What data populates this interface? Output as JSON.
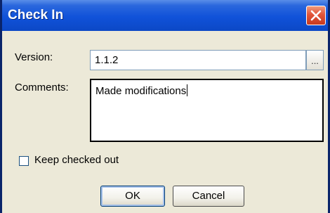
{
  "window": {
    "title": "Check In"
  },
  "form": {
    "version_label": "Version:",
    "version_value": "1.1.2",
    "browse_label": "...",
    "comments_label": "Comments:",
    "comments_value": "Made modifications",
    "keep_checked_out_label": "Keep checked out",
    "keep_checked_out": false
  },
  "buttons": {
    "ok": "OK",
    "cancel": "Cancel"
  },
  "icons": {
    "close": "close-icon"
  },
  "colors": {
    "title_bar": "#1052d9",
    "close_button": "#e2553a",
    "dialog_bg": "#ece9d8"
  }
}
